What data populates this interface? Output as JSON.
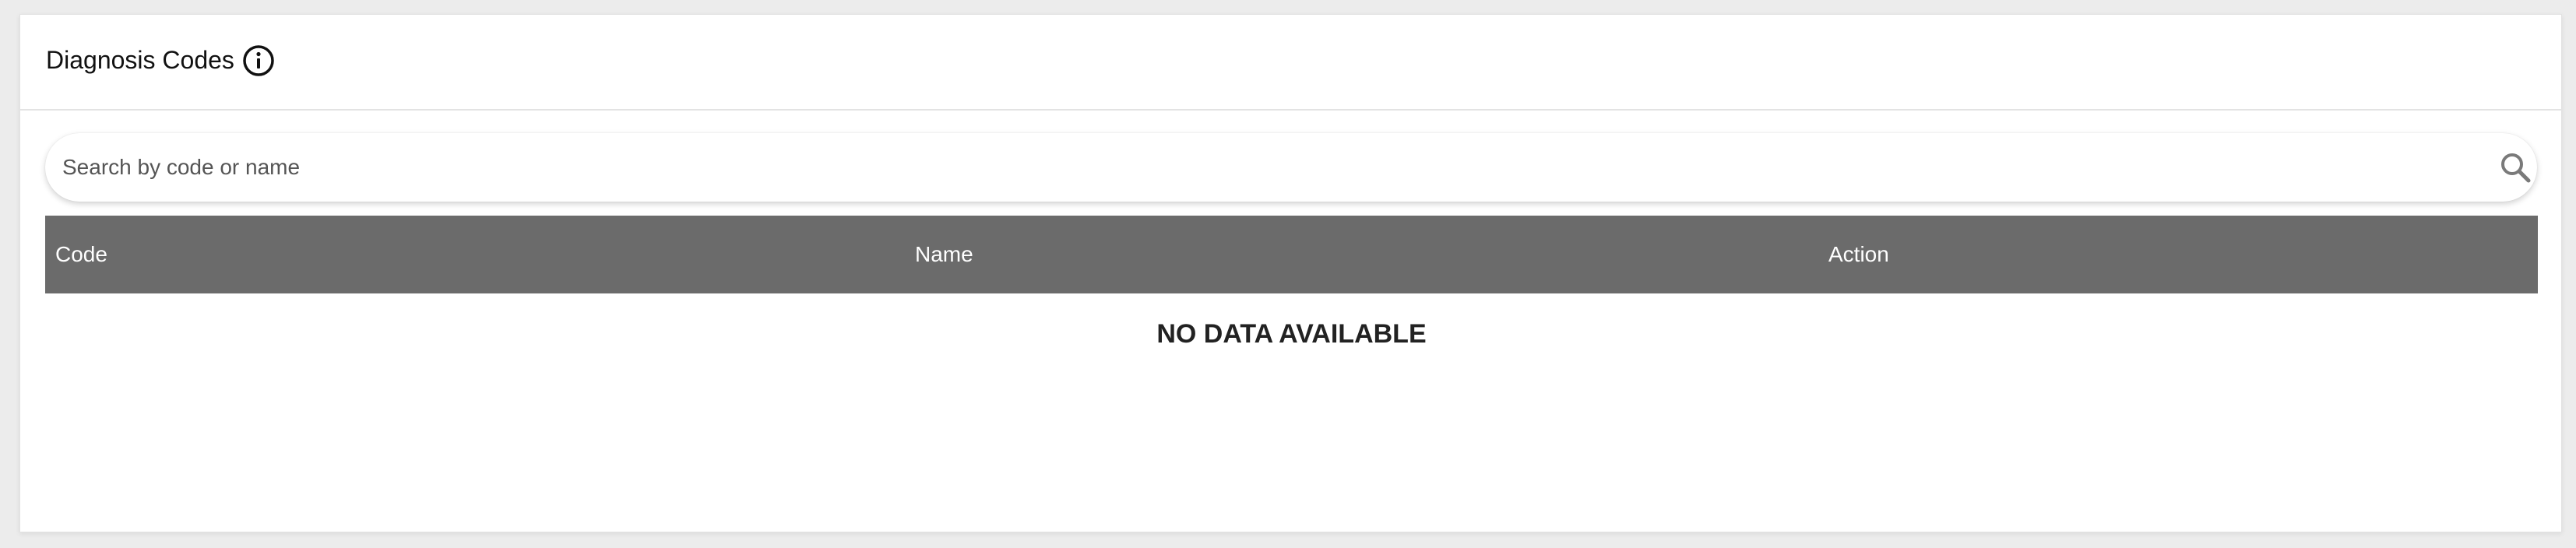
{
  "card": {
    "title": "Diagnosis Codes",
    "info_icon": "info-icon"
  },
  "search": {
    "placeholder": "Search by code or name",
    "value": "",
    "icon": "search-icon"
  },
  "table": {
    "columns": [
      "Code",
      "Name",
      "Action"
    ],
    "rows": [],
    "empty_message": "NO DATA AVAILABLE",
    "header_color": "#6b6b6b"
  }
}
